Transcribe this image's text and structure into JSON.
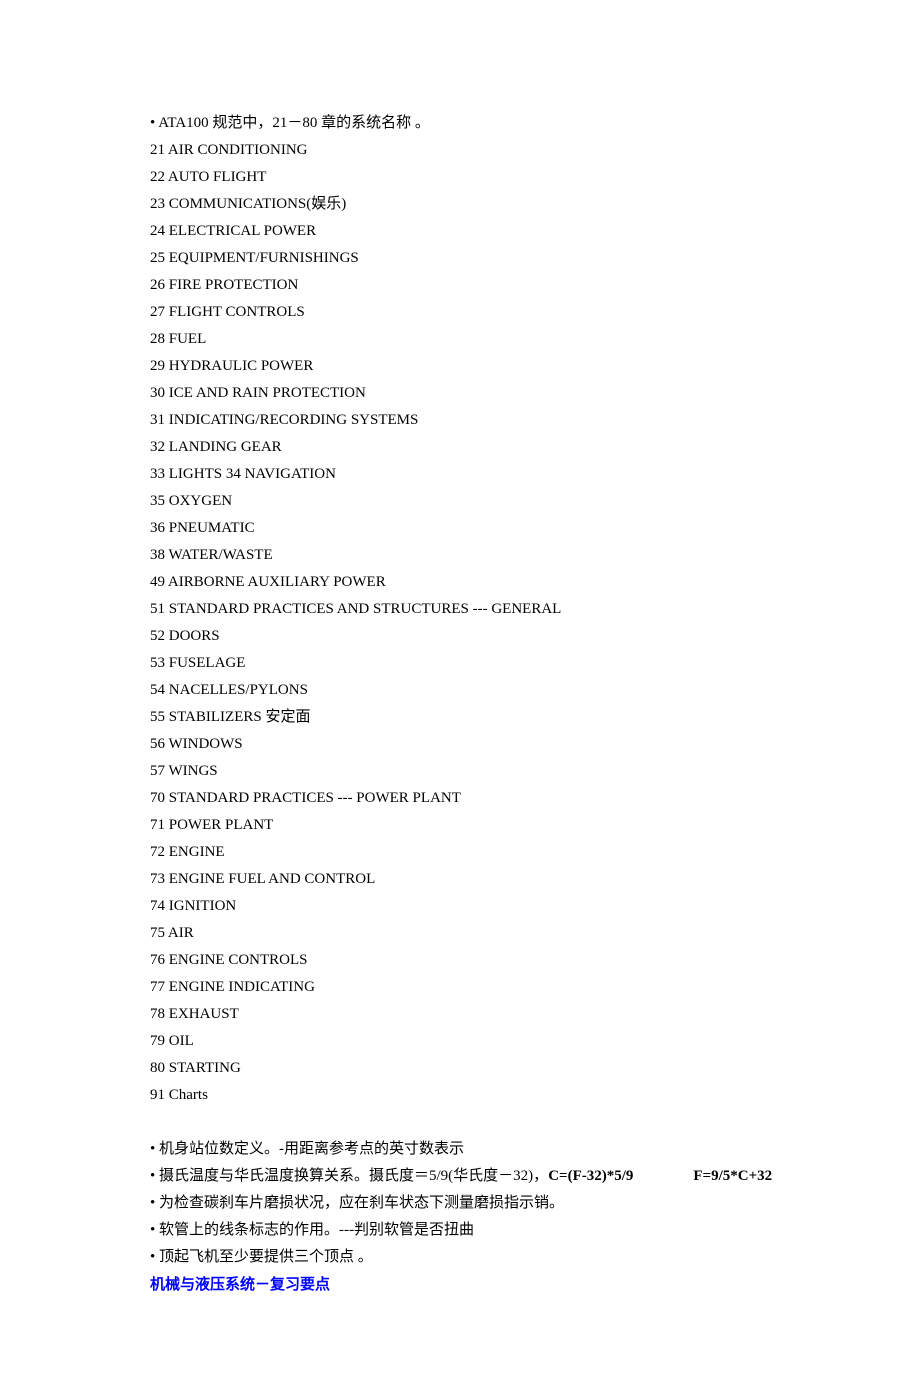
{
  "intro": "ATA100 规范中，21－80 章的系统名称 。",
  "chapters": [
    "21 AIR CONDITIONING",
    "22 AUTO FLIGHT",
    "23 COMMUNICATIONS(娱乐)",
    "24 ELECTRICAL POWER",
    "25 EQUIPMENT/FURNISHINGS",
    "26 FIRE PROTECTION",
    "27 FLIGHT CONTROLS",
    "28 FUEL",
    "29 HYDRAULIC POWER",
    "30 ICE AND RAIN PROTECTION",
    "31 INDICATING/RECORDING SYSTEMS",
    "32 LANDING GEAR",
    "33 LIGHTS 34 NAVIGATION",
    "35 OXYGEN",
    "36 PNEUMATIC",
    "38 WATER/WASTE",
    "49 AIRBORNE AUXILIARY POWER",
    "51 STANDARD PRACTICES AND STRUCTURES --- GENERAL",
    "52 DOORS",
    "53 FUSELAGE",
    "54 NACELLES/PYLONS",
    "55 STABILIZERS 安定面",
    "56 WINDOWS",
    "57 WINGS",
    "70 STANDARD PRACTICES --- POWER PLANT",
    "71 POWER PLANT",
    "72 ENGINE",
    "73 ENGINE FUEL AND CONTROL",
    "74 IGNITION",
    "75 AIR",
    "76 ENGINE CONTROLS",
    "77 ENGINE INDICATING",
    "78 EXHAUST",
    "79 OIL",
    "80 STARTING",
    "91 Charts"
  ],
  "notes": {
    "n1": "机身站位数定义。-用距离参考点的英寸数表示",
    "n2_a": "摄氏温度与华氏温度换算关系。摄氏度＝5/9(华氏度－32)，",
    "n2_b": "C=(F-32)*5/9",
    "n2_c": "F=9/5*C+32",
    "n3": "为检查碳刹车片磨损状况，应在刹车状态下测量磨损指示销。",
    "n4": "软管上的线条标志的作用。---判别软管是否扭曲",
    "n5": "顶起飞机至少要提供三个顶点 。"
  },
  "section_title": "机械与液压系统－复习要点"
}
